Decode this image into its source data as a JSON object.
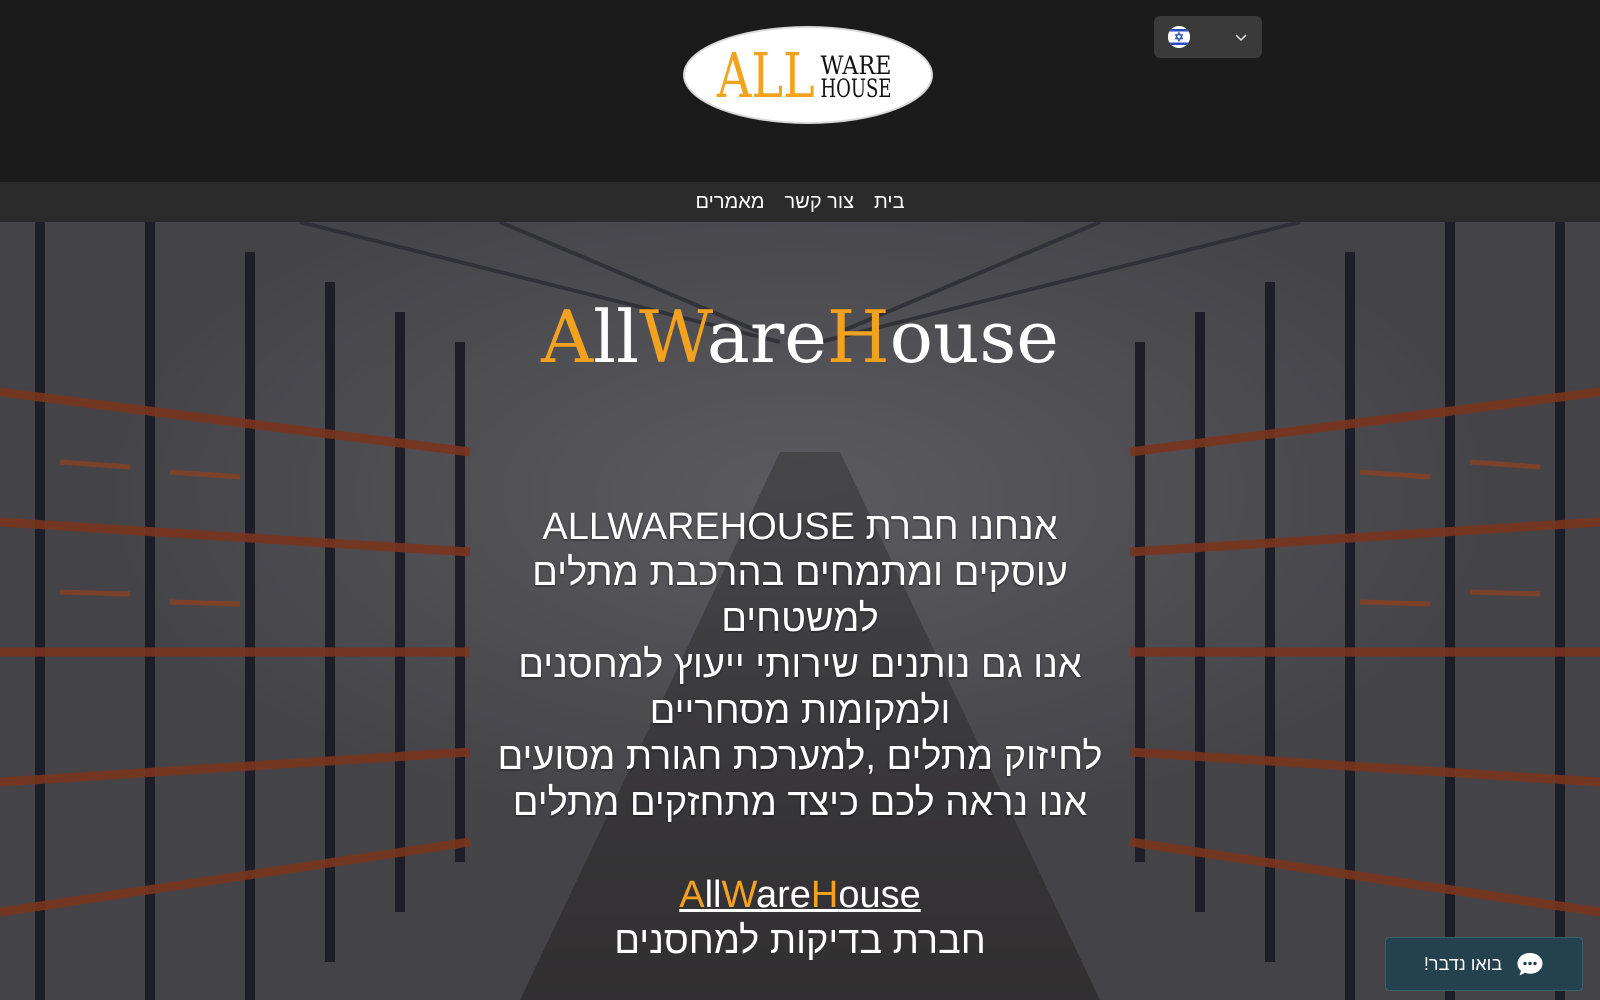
{
  "header": {
    "logo": {
      "word_all": "ALL",
      "word_ware": "WARE",
      "word_house": "HOUSE"
    },
    "language": {
      "flag": "israel-flag-icon",
      "dropdown_icon": "chevron-down-icon"
    }
  },
  "nav": {
    "items": [
      {
        "label": "בית"
      },
      {
        "label": "צור קשר"
      },
      {
        "label": "מאמרים"
      }
    ]
  },
  "hero": {
    "title": {
      "p1": "A",
      "p2": "ll",
      "p3": "W",
      "p4": "are",
      "p5": "H",
      "p6": "ouse"
    },
    "about_lines": [
      "אנחנו חברת ALLWAREHOUSE",
      "עוסקים ומתמחים בהרכבת מתלים",
      "למשטחים",
      "אנו גם נותנים שירותי ייעוץ למחסנים",
      "ולמקומות מסחריים",
      "לחיזוק מתלים ,למערכת חגורת מסועים",
      "אנו נראה לכם כיצד מתחזקים מתלים"
    ],
    "brand_link": {
      "p1": "A",
      "p2": "ll",
      "p3": "W",
      "p4": "are",
      "p5": "H",
      "p6": "ouse"
    },
    "tagline": "חברת בדיקות למחסנים"
  },
  "chat": {
    "label": "בואו נדבר!",
    "icon": "chat-bubble-icon"
  },
  "colors": {
    "accent": "#f3a21f",
    "header_bg": "#1b1b1b",
    "nav_bg": "#2b2b2b",
    "chat_bg": "#24414e"
  }
}
